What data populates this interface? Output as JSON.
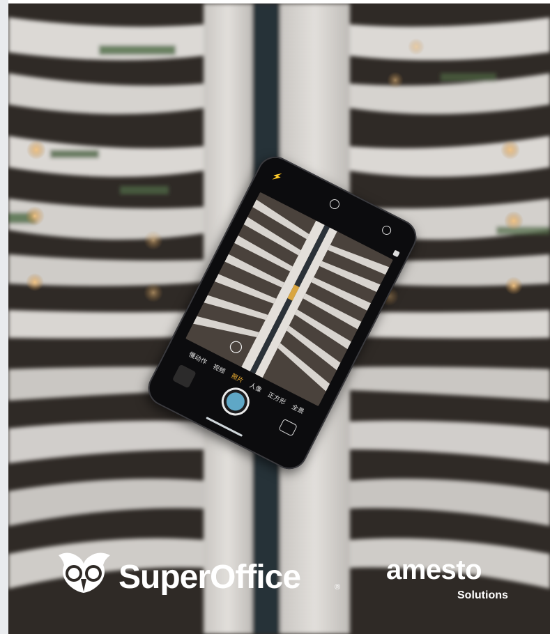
{
  "photo": {
    "description_icon": "atrium-photo",
    "camera_modes": [
      "慢动作",
      "视频",
      "照片",
      "人像",
      "正方形",
      "全景"
    ],
    "active_mode_index": 2
  },
  "brands": {
    "superoffice": {
      "name": "SuperOffice",
      "registered_mark": "®"
    },
    "amesto": {
      "name": "amesto",
      "tagline": "Solutions"
    }
  },
  "colors": {
    "left_strip": "#e9ebee",
    "shutter_inner": "#5fa7c6",
    "active_mode": "#f2b233",
    "logo_white": "#ffffff"
  }
}
